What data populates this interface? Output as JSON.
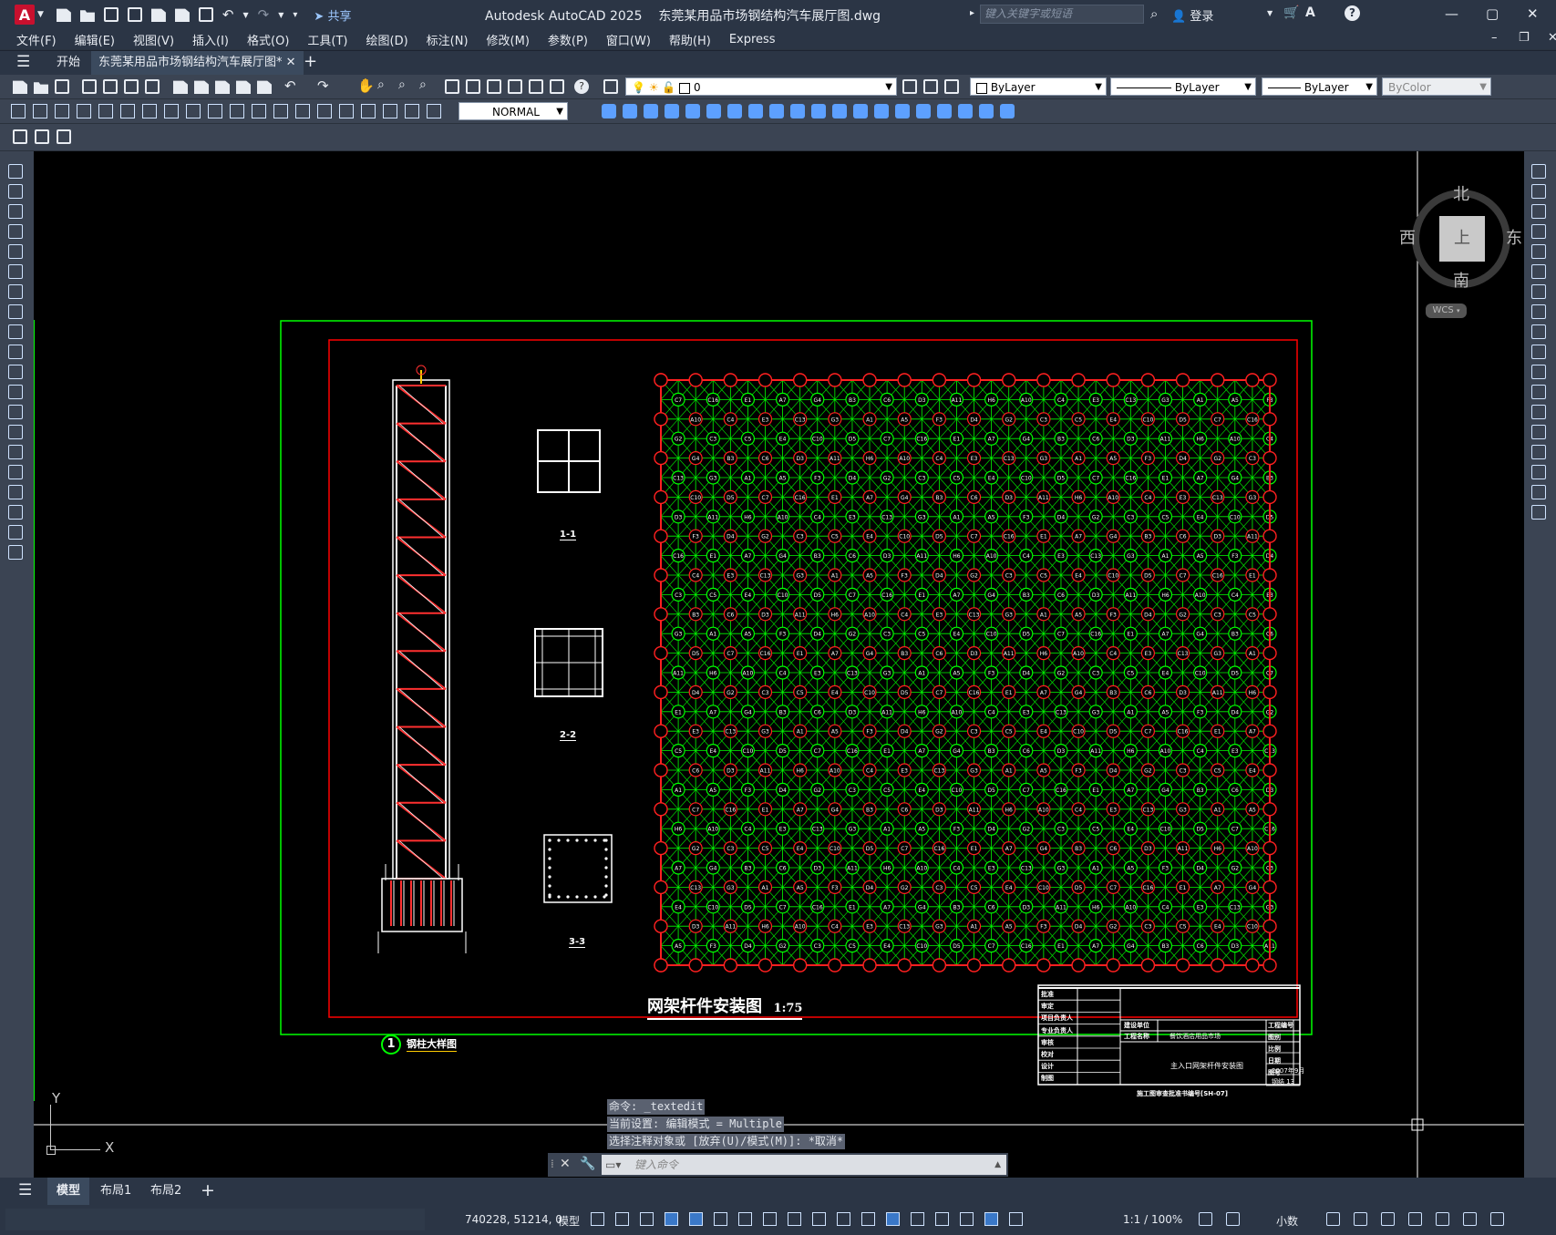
{
  "app": {
    "logo": "A",
    "title": "Autodesk AutoCAD 2025",
    "file": "东莞某用品市场钢结构汽车展厅图.dwg"
  },
  "title_bar": {
    "share": "共享",
    "search_placeholder": "键入关键字或短语",
    "login": "登录"
  },
  "menu": [
    "文件(F)",
    "编辑(E)",
    "视图(V)",
    "插入(I)",
    "格式(O)",
    "工具(T)",
    "绘图(D)",
    "标注(N)",
    "修改(M)",
    "参数(P)",
    "窗口(W)",
    "帮助(H)",
    "Express"
  ],
  "tabs": {
    "start": "开始",
    "doc": "东莞某用品市场钢结构汽车展厅图*"
  },
  "toolbar": {
    "layer": "0",
    "color": "ByLayer",
    "linetype": "ByLayer",
    "lineweight": "ByLayer",
    "plotstyle": "ByColor",
    "dimstyle": "NORMAL"
  },
  "viewcube": {
    "north": "北",
    "south": "南",
    "east": "东",
    "west": "西",
    "face": "上",
    "wcs": "WCS"
  },
  "drawing": {
    "title": "网架杆件安装图",
    "scale": "1:75",
    "column_label": "钢柱大样图",
    "column_num": "1",
    "section1": "1-1",
    "section2": "2-2",
    "section3": "3-3",
    "grid_rows": [
      "D3",
      "H3",
      "D5",
      "G5",
      "H2",
      "D3",
      "H3",
      "D5",
      "H5",
      "D2",
      "D3",
      "H3",
      "D5",
      "H2",
      "D3",
      "H3",
      "D5",
      "H5",
      "D3",
      "D5",
      "D3",
      "H3",
      "D5",
      "H5",
      "D3",
      "H3",
      "D5",
      "D3",
      "C1",
      "A1"
    ],
    "node_labels": [
      "A1",
      "C1",
      "D3",
      "H3",
      "D5",
      "B1",
      "A5",
      "A9",
      "A11",
      "B5",
      "C7",
      "E2",
      "F3",
      "G1",
      "H6",
      "C14",
      "C16",
      "C12",
      "D4",
      "A12",
      "A10",
      "B2",
      "E1",
      "F4",
      "G2",
      "H5",
      "C4",
      "A3",
      "A7",
      "B7",
      "C3",
      "D1",
      "E3",
      "F2",
      "G4",
      "H4",
      "C5",
      "C9",
      "C13",
      "A2",
      "B3",
      "D2",
      "E4",
      "F1",
      "G3",
      "H1",
      "C6",
      "C8",
      "C10",
      "C11"
    ]
  },
  "titleblock": {
    "rows_left": [
      "批准",
      "审定",
      "项目负责人",
      "专业负责人",
      "审核",
      "校对",
      "设计",
      "制图"
    ],
    "company_label": "建设单位",
    "project_label": "工程名称",
    "project": "餐饮酒店用品市场",
    "drawing_name": "主入口网架杆件安装图",
    "code_label": "工程编号",
    "r2": "图别",
    "r3": "比例",
    "r4": "日期",
    "date": "2007年9月",
    "r5": "图号",
    "sheet": "钢结 13",
    "footer": "施工图审查批准书编号[SH-07]"
  },
  "command": {
    "line1": "命令: _textedit",
    "line2": "当前设置: 编辑模式 = Multiple",
    "line3": "选择注释对象或 [放弃(U)/模式(M)]: *取消*",
    "placeholder": "键入命令"
  },
  "layouts": [
    "模型",
    "布局1",
    "布局2"
  ],
  "status": {
    "coords": "740228, 51214, 0",
    "mode": "模型",
    "scale": "1:1 / 100%",
    "units": "小数"
  },
  "colors": {
    "canvas": "#000000",
    "grid_green": "#00ff00",
    "frame_red": "#ff0000",
    "node_red": "#ff2020"
  }
}
